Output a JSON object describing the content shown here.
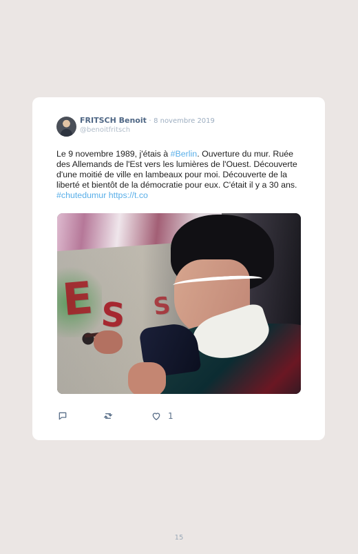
{
  "tweet": {
    "author_name": "FRITSCH Benoit",
    "separator": "·",
    "date": "8 novembre 2019",
    "handle": "@benoitfritsch",
    "text_part_1": "Le 9 novembre 1989, j'étais à ",
    "hashtag_1": "#Berlin",
    "text_part_2": ". Ouverture du mur. Ruée des Allemands de l'Est vers les lumières de l'Ouest. Découverte d'une moitié de ville en lambeaux pour moi. Découverte de la liberté et bientôt de la démocratie pour eux. C'était il y a 30 ans. ",
    "hashtag_2": "#chutedumur",
    "link_text": "https://t.co",
    "like_count": "1"
  },
  "icons": {
    "reply": "reply-icon",
    "retweet": "retweet-icon",
    "like": "heart-icon"
  },
  "page": {
    "number": "15"
  },
  "colors": {
    "background": "#ebe6e4",
    "card": "#ffffff",
    "link": "#58aee8",
    "text": "#1d1d1d",
    "muted": "#9cadc0"
  }
}
